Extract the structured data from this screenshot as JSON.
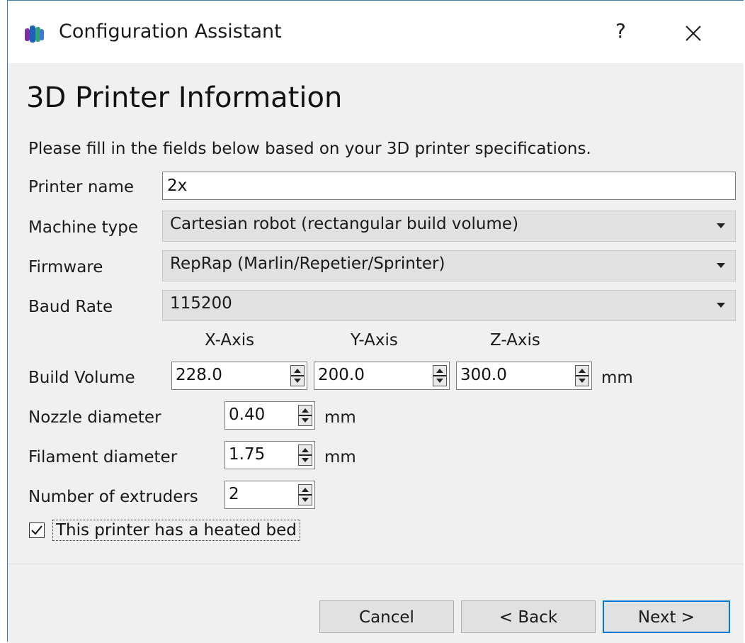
{
  "window": {
    "title": "Configuration Assistant",
    "help_label": "?"
  },
  "page": {
    "heading": "3D Printer Information",
    "description": "Please fill in the fields below based on your 3D printer specifications."
  },
  "fields": {
    "printer_name_label": "Printer name",
    "printer_name_value": "2x",
    "machine_type_label": "Machine type",
    "machine_type_value": "Cartesian robot (rectangular build volume)",
    "firmware_label": "Firmware",
    "firmware_value": "RepRap (Marlin/Repetier/Sprinter)",
    "baud_rate_label": "Baud Rate",
    "baud_rate_value": "115200",
    "axes": {
      "x": "X-Axis",
      "y": "Y-Axis",
      "z": "Z-Axis"
    },
    "build_volume_label": "Build Volume",
    "build_volume_x": "228.0",
    "build_volume_y": "200.0",
    "build_volume_z": "300.0",
    "build_volume_unit": "mm",
    "nozzle_label": "Nozzle diameter",
    "nozzle_value": "0.40",
    "nozzle_unit": "mm",
    "filament_label": "Filament diameter",
    "filament_value": "1.75",
    "filament_unit": "mm",
    "extruders_label": "Number of extruders",
    "extruders_value": "2",
    "heated_bed_label": "This printer has a heated bed",
    "heated_bed_checked": true
  },
  "buttons": {
    "cancel": "Cancel",
    "back": "< Back",
    "next": "Next >"
  },
  "colors": {
    "accent": "#0078d7",
    "window_border": "#3c7fb1"
  }
}
